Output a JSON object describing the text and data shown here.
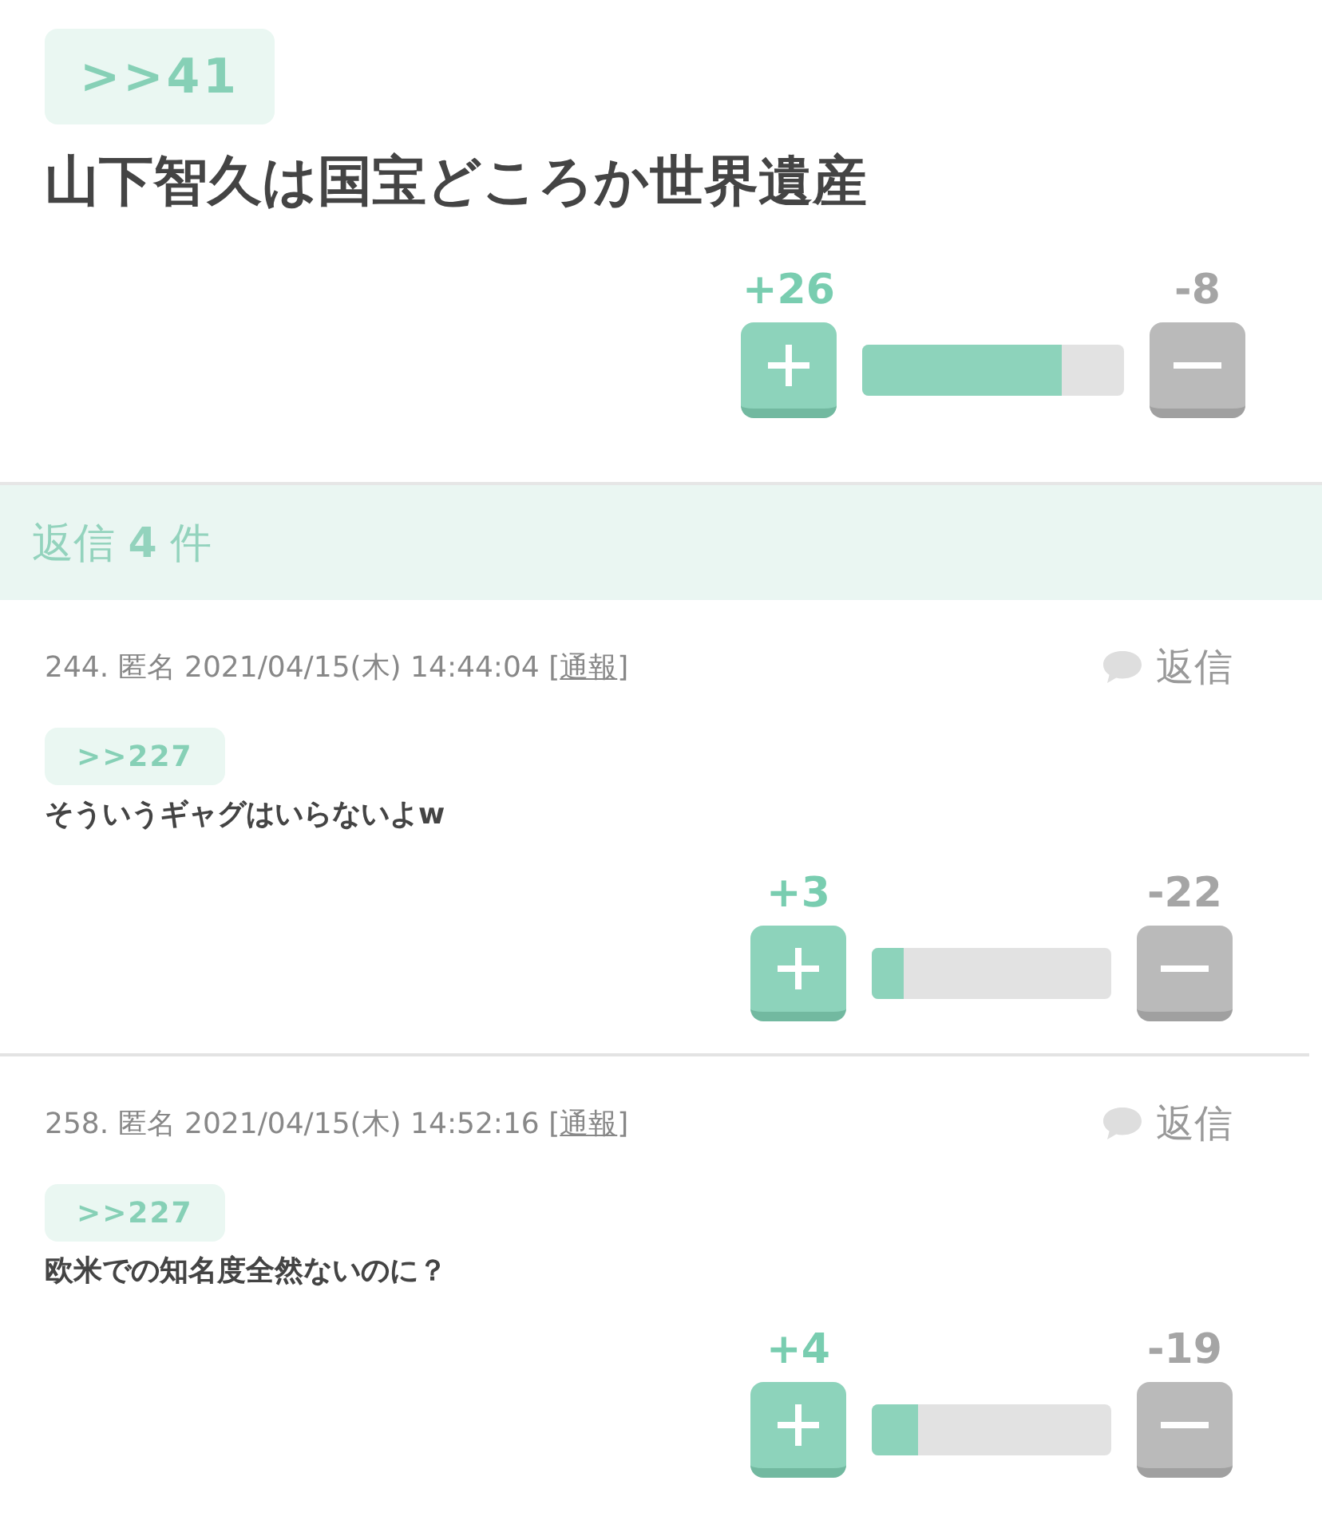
{
  "post": {
    "anchor": ">>41",
    "title": "山下智久は国宝どころか世界遺産",
    "votes": {
      "plus": "+26",
      "minus": "-8",
      "level": 0.76
    }
  },
  "replies_header": {
    "label": "返信",
    "count": "4",
    "unit": "件"
  },
  "comments": [
    {
      "meta": "244. 匿名 2021/04/15(木) 14:44:04 [",
      "report": "通報",
      "meta_end": "]",
      "reply": "返信",
      "anchor": ">>227",
      "body": "そういうギャグはいらないよw",
      "votes": {
        "plus": "+3",
        "minus": "-22",
        "level": 0.13
      }
    },
    {
      "meta": "258. 匿名 2021/04/15(木) 14:52:16 [",
      "report": "通報",
      "meta_end": "]",
      "reply": "返信",
      "anchor": ">>227",
      "body": "欧米での知名度全然ないのに？",
      "votes": {
        "plus": "+4",
        "minus": "-19",
        "level": 0.19
      }
    }
  ]
}
